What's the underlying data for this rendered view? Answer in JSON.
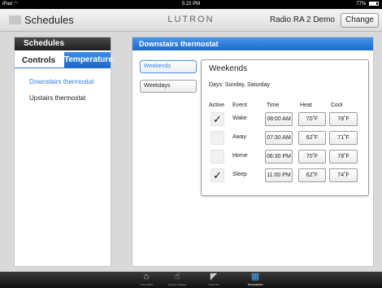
{
  "status_bar": {
    "device": "iPad",
    "wifi_icon": "wifi-icon",
    "time": "5:22 PM",
    "battery": "77%",
    "battery_level": 0.77
  },
  "header": {
    "title": "Schedules",
    "brand": "LUTRON",
    "system_name": "Radio RA 2 Demo",
    "change_label": "Change",
    "menu_icon": "menu-icon"
  },
  "left_panel": {
    "title": "Schedules",
    "tab_controls": "Controls",
    "tab_temperature": "Temperature",
    "items": [
      {
        "label": "Downstairs thermostat",
        "active": true
      },
      {
        "label": "Upstairs thermostat",
        "active": false
      }
    ]
  },
  "main_panel": {
    "title": "Downstairs thermostat",
    "day_tabs": [
      {
        "label": "Weekends",
        "selected": true
      },
      {
        "label": "Weekdays",
        "selected": false
      }
    ],
    "schedule": {
      "title": "Weekends",
      "days_line": "Days:  Sunday, Saturday",
      "columns": [
        "Active",
        "Event",
        "Time",
        "Heat",
        "Cool"
      ],
      "rows": [
        {
          "active": true,
          "event": "Wake",
          "time": "08:00 AM",
          "heat": "70˚F",
          "cool": "78˚F"
        },
        {
          "active": false,
          "event": "Away",
          "time": "07:30 AM",
          "heat": "62˚F",
          "cool": "71˚F"
        },
        {
          "active": false,
          "event": "Home",
          "time": "06:30 PM",
          "heat": "70˚F",
          "cool": "78˚F"
        },
        {
          "active": true,
          "event": "Sleep",
          "time": "11:00 PM",
          "heat": "62˚F",
          "cool": "74˚F"
        }
      ],
      "check_mark": "✓"
    }
  },
  "colors": {
    "accent": "#2f7fe0",
    "title_bar_dark": "#1e1e1e"
  },
  "tab_bar": [
    {
      "icon": "home-icon",
      "glyph": "⌂",
      "label": "Favorites",
      "active": false
    },
    {
      "icon": "hand-icon",
      "glyph": "☝",
      "label": "Quick Adjust",
      "active": false
    },
    {
      "icon": "scenes-icon",
      "glyph": "◤",
      "label": "Scenes",
      "active": false
    },
    {
      "icon": "calendar-icon",
      "glyph": "▦",
      "label": "Schedules",
      "active": true
    }
  ]
}
